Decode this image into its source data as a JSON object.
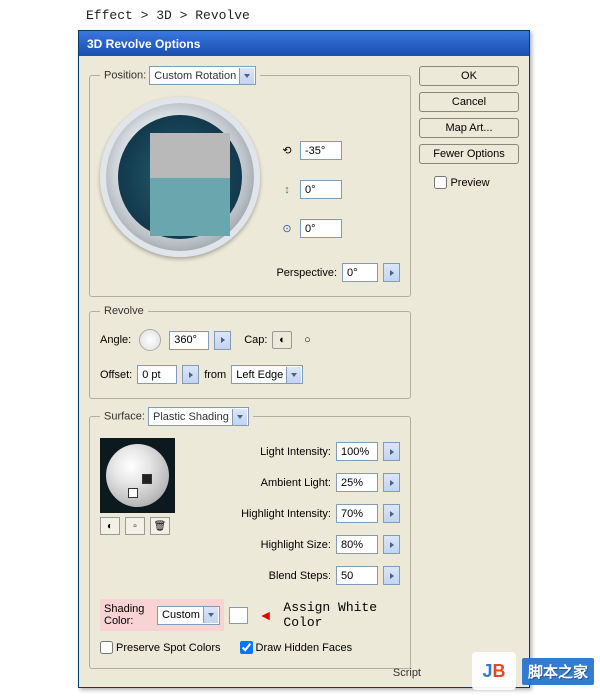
{
  "breadcrumb": "Effect > 3D > Revolve",
  "dialog": {
    "title": "3D Revolve Options"
  },
  "buttons": {
    "ok": "OK",
    "cancel": "Cancel",
    "map_art": "Map Art...",
    "fewer": "Fewer Options"
  },
  "preview": {
    "label": "Preview"
  },
  "position": {
    "legend": "Position",
    "dropdown": "Custom Rotation",
    "rot_x": "-35°",
    "rot_y": "0°",
    "rot_z": "0°",
    "perspective_label": "Perspective:",
    "perspective": "0°"
  },
  "revolve": {
    "legend": "Revolve",
    "angle_label": "Angle:",
    "angle": "360°",
    "cap_label": "Cap:",
    "offset_label": "Offset:",
    "offset": "0 pt",
    "from_label": "from",
    "from": "Left Edge"
  },
  "surface": {
    "legend": "Surface:",
    "shading": "Plastic Shading",
    "light_intensity_label": "Light Intensity:",
    "light_intensity": "100%",
    "ambient_label": "Ambient Light:",
    "ambient": "25%",
    "highlight_intensity_label": "Highlight Intensity:",
    "highlight_intensity": "70%",
    "highlight_size_label": "Highlight Size:",
    "highlight_size": "80%",
    "blend_label": "Blend Steps:",
    "blend": "50",
    "shading_color_label": "Shading Color:",
    "shading_color": "Custom",
    "preserve_label": "Preserve Spot Colors",
    "hidden_label": "Draw Hidden Faces"
  },
  "annotation": {
    "arrow": "◄",
    "text": "Assign White Color"
  },
  "script_label": "Script",
  "watermark": {
    "logo_j": "J",
    "logo_b": "B",
    "text": "脚本之家"
  }
}
